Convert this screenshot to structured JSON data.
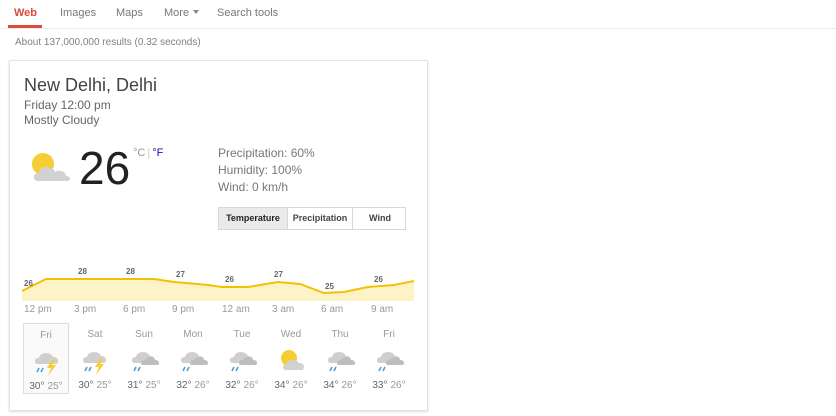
{
  "nav": {
    "tabs": [
      "Web",
      "Images",
      "Maps",
      "More",
      "Search tools"
    ],
    "active": "Web"
  },
  "results_stats": "About 137,000,000 results (0.32 seconds)",
  "weather": {
    "location": "New Delhi, Delhi",
    "datetime": "Friday 12:00 pm",
    "condition": "Mostly Cloudy",
    "current_icon": "partly-cloudy-icon",
    "temperature": "26",
    "unit_c": "°C",
    "unit_sep": "|",
    "unit_f": "°F",
    "precipitation": "Precipitation: 60%",
    "humidity": "Humidity: 100%",
    "wind": "Wind: 0 km/h",
    "chart_tabs": [
      "Temperature",
      "Precipitation",
      "Wind"
    ],
    "chart_tab_active": "Temperature",
    "hourly_labels": [
      "26",
      "28",
      "28",
      "27",
      "26",
      "27",
      "25",
      "26"
    ],
    "hourly_times": [
      "12 pm",
      "3 pm",
      "6 pm",
      "9 pm",
      "12 am",
      "3 am",
      "6 am",
      "9 am"
    ],
    "colors": {
      "line": "#f2c200",
      "fill": "#fdf3c7",
      "accent": "#dd4b39",
      "link": "#1a0dab"
    },
    "daily": [
      {
        "day": "Fri",
        "icon": "thunderstorm-icon",
        "hi": "30°",
        "lo": "25°",
        "selected": true
      },
      {
        "day": "Sat",
        "icon": "thunderstorm-icon",
        "hi": "30°",
        "lo": "25°",
        "selected": false
      },
      {
        "day": "Sun",
        "icon": "rain-icon",
        "hi": "31°",
        "lo": "25°",
        "selected": false
      },
      {
        "day": "Mon",
        "icon": "rain-icon",
        "hi": "32°",
        "lo": "26°",
        "selected": false
      },
      {
        "day": "Tue",
        "icon": "rain-icon",
        "hi": "32°",
        "lo": "26°",
        "selected": false
      },
      {
        "day": "Wed",
        "icon": "partly-cloudy-icon",
        "hi": "34°",
        "lo": "26°",
        "selected": false
      },
      {
        "day": "Thu",
        "icon": "rain-icon",
        "hi": "34°",
        "lo": "26°",
        "selected": false
      },
      {
        "day": "Fri",
        "icon": "rain-icon",
        "hi": "33°",
        "lo": "26°",
        "selected": false
      }
    ]
  }
}
